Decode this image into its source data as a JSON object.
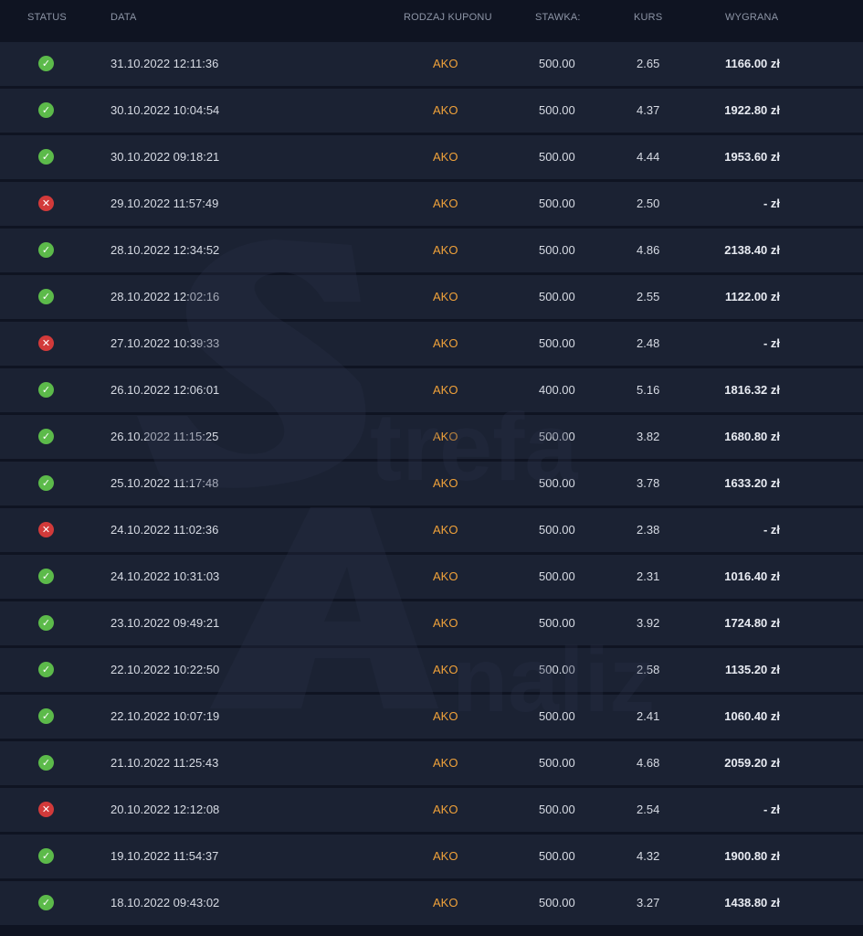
{
  "header": {
    "status": "STATUS",
    "date": "DATA",
    "coupon_type": "RODZAJ KUPONU",
    "stake": "STAWKA:",
    "odds": "KURS",
    "win": "WYGRANA"
  },
  "colors": {
    "win_status": "#5cba4a",
    "loss_status": "#d23a3a",
    "coupon_type": "#f0a23a",
    "row_background": "#1b2233",
    "page_background": "#0f1422"
  },
  "rows": [
    {
      "status": "win",
      "status_icon": "check-circle-icon",
      "glyph": "✓",
      "date": "31.10.2022 12:11:36",
      "type": "AKO",
      "stake": "500.00",
      "odds": "2.65",
      "win": "1166.00 zł"
    },
    {
      "status": "win",
      "status_icon": "check-circle-icon",
      "glyph": "✓",
      "date": "30.10.2022 10:04:54",
      "type": "AKO",
      "stake": "500.00",
      "odds": "4.37",
      "win": "1922.80 zł"
    },
    {
      "status": "win",
      "status_icon": "check-circle-icon",
      "glyph": "✓",
      "date": "30.10.2022 09:18:21",
      "type": "AKO",
      "stake": "500.00",
      "odds": "4.44",
      "win": "1953.60 zł"
    },
    {
      "status": "loss",
      "status_icon": "cross-circle-icon",
      "glyph": "✕",
      "date": "29.10.2022 11:57:49",
      "type": "AKO",
      "stake": "500.00",
      "odds": "2.50",
      "win": "- zł"
    },
    {
      "status": "win",
      "status_icon": "check-circle-icon",
      "glyph": "✓",
      "date": "28.10.2022 12:34:52",
      "type": "AKO",
      "stake": "500.00",
      "odds": "4.86",
      "win": "2138.40 zł"
    },
    {
      "status": "win",
      "status_icon": "check-circle-icon",
      "glyph": "✓",
      "date": "28.10.2022 12:02:16",
      "type": "AKO",
      "stake": "500.00",
      "odds": "2.55",
      "win": "1122.00 zł"
    },
    {
      "status": "loss",
      "status_icon": "cross-circle-icon",
      "glyph": "✕",
      "date": "27.10.2022 10:39:33",
      "type": "AKO",
      "stake": "500.00",
      "odds": "2.48",
      "win": "- zł"
    },
    {
      "status": "win",
      "status_icon": "check-circle-icon",
      "glyph": "✓",
      "date": "26.10.2022 12:06:01",
      "type": "AKO",
      "stake": "400.00",
      "odds": "5.16",
      "win": "1816.32 zł"
    },
    {
      "status": "win",
      "status_icon": "check-circle-icon",
      "glyph": "✓",
      "date": "26.10.2022 11:15:25",
      "type": "AKO",
      "stake": "500.00",
      "odds": "3.82",
      "win": "1680.80 zł"
    },
    {
      "status": "win",
      "status_icon": "check-circle-icon",
      "glyph": "✓",
      "date": "25.10.2022 11:17:48",
      "type": "AKO",
      "stake": "500.00",
      "odds": "3.78",
      "win": "1633.20 zł"
    },
    {
      "status": "loss",
      "status_icon": "cross-circle-icon",
      "glyph": "✕",
      "date": "24.10.2022 11:02:36",
      "type": "AKO",
      "stake": "500.00",
      "odds": "2.38",
      "win": "- zł"
    },
    {
      "status": "win",
      "status_icon": "check-circle-icon",
      "glyph": "✓",
      "date": "24.10.2022 10:31:03",
      "type": "AKO",
      "stake": "500.00",
      "odds": "2.31",
      "win": "1016.40 zł"
    },
    {
      "status": "win",
      "status_icon": "check-circle-icon",
      "glyph": "✓",
      "date": "23.10.2022 09:49:21",
      "type": "AKO",
      "stake": "500.00",
      "odds": "3.92",
      "win": "1724.80 zł"
    },
    {
      "status": "win",
      "status_icon": "check-circle-icon",
      "glyph": "✓",
      "date": "22.10.2022 10:22:50",
      "type": "AKO",
      "stake": "500.00",
      "odds": "2.58",
      "win": "1135.20 zł"
    },
    {
      "status": "win",
      "status_icon": "check-circle-icon",
      "glyph": "✓",
      "date": "22.10.2022 10:07:19",
      "type": "AKO",
      "stake": "500.00",
      "odds": "2.41",
      "win": "1060.40 zł"
    },
    {
      "status": "win",
      "status_icon": "check-circle-icon",
      "glyph": "✓",
      "date": "21.10.2022 11:25:43",
      "type": "AKO",
      "stake": "500.00",
      "odds": "4.68",
      "win": "2059.20 zł"
    },
    {
      "status": "loss",
      "status_icon": "cross-circle-icon",
      "glyph": "✕",
      "date": "20.10.2022 12:12:08",
      "type": "AKO",
      "stake": "500.00",
      "odds": "2.54",
      "win": "- zł"
    },
    {
      "status": "win",
      "status_icon": "check-circle-icon",
      "glyph": "✓",
      "date": "19.10.2022 11:54:37",
      "type": "AKO",
      "stake": "500.00",
      "odds": "4.32",
      "win": "1900.80 zł"
    },
    {
      "status": "win",
      "status_icon": "check-circle-icon",
      "glyph": "✓",
      "date": "18.10.2022 09:43:02",
      "type": "AKO",
      "stake": "500.00",
      "odds": "3.27",
      "win": "1438.80 zł"
    }
  ],
  "watermark": {
    "word1": "trefa",
    "word2": "naliz"
  }
}
